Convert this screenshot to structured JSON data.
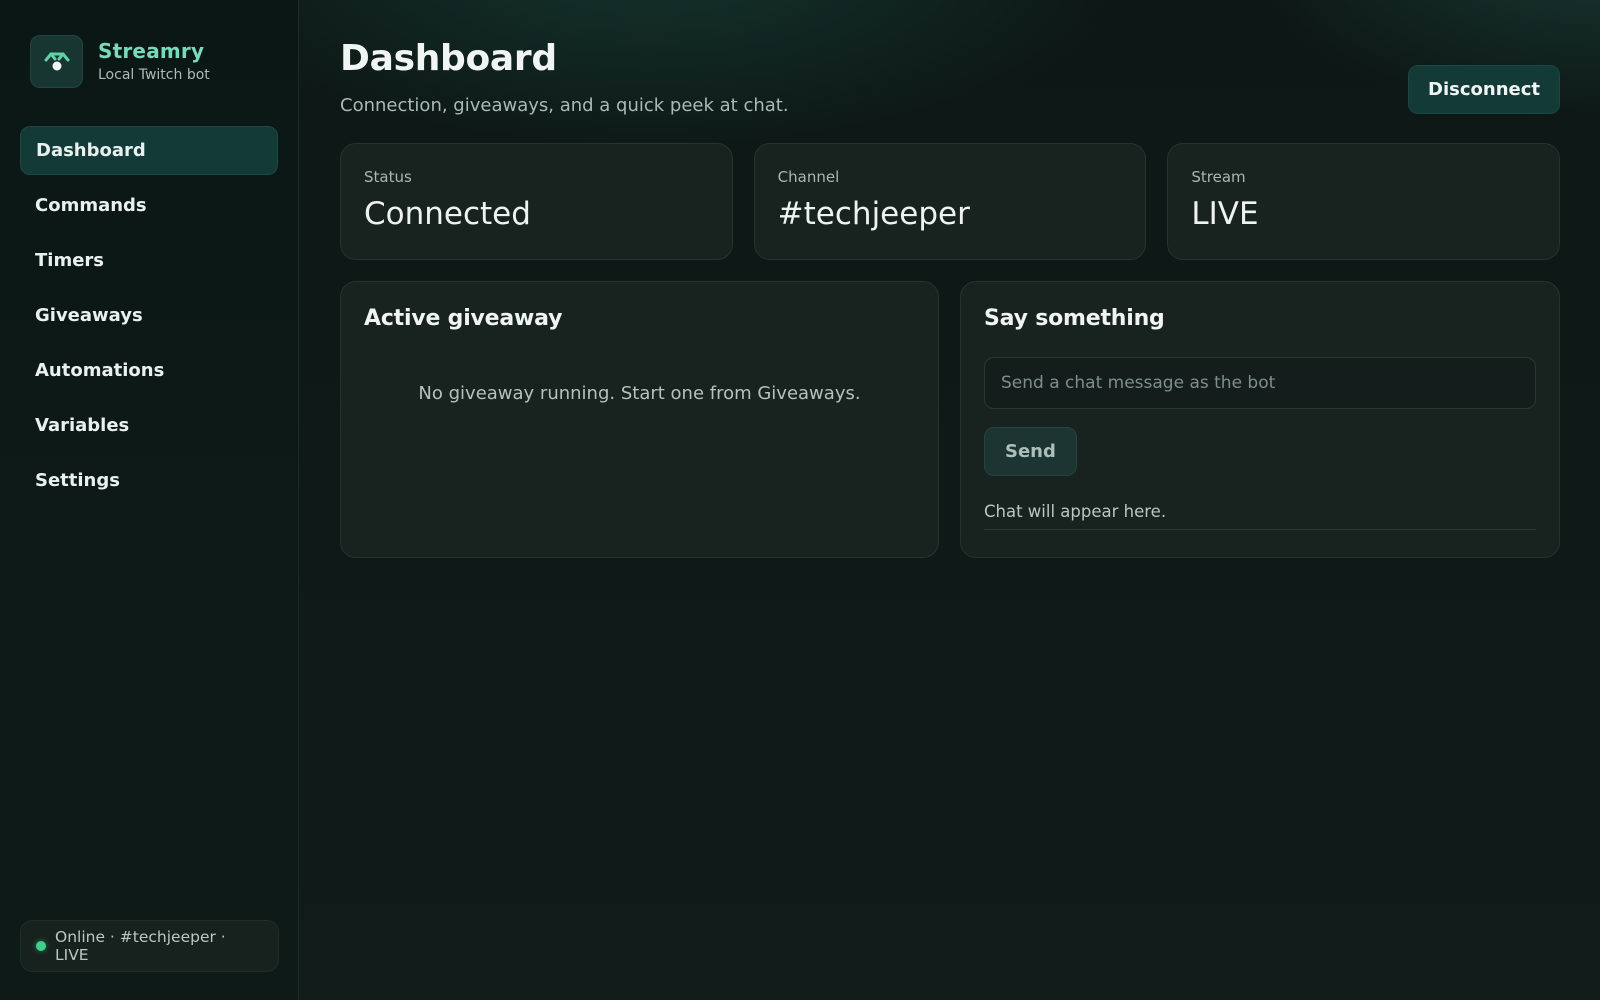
{
  "brand": {
    "name": "Streamry",
    "subtitle": "Local Twitch bot",
    "logo_icon": "robot-antenna-icon",
    "accent": "#79d9b8"
  },
  "sidebar": {
    "items": [
      {
        "label": "Dashboard",
        "active": true
      },
      {
        "label": "Commands",
        "active": false
      },
      {
        "label": "Timers",
        "active": false
      },
      {
        "label": "Giveaways",
        "active": false
      },
      {
        "label": "Automations",
        "active": false
      },
      {
        "label": "Variables",
        "active": false
      },
      {
        "label": "Settings",
        "active": false
      }
    ],
    "status_text": "Online · #techjeeper · LIVE",
    "status_color": "#3fd18c"
  },
  "header": {
    "title": "Dashboard",
    "subtitle": "Connection, giveaways, and a quick peek at chat.",
    "disconnect_label": "Disconnect"
  },
  "stats": [
    {
      "label": "Status",
      "value": "Connected"
    },
    {
      "label": "Channel",
      "value": "#techjeeper"
    },
    {
      "label": "Stream",
      "value": "LIVE"
    }
  ],
  "giveaway": {
    "title": "Active giveaway",
    "empty_message": "No giveaway running. Start one from Giveaways."
  },
  "chat": {
    "title": "Say something",
    "input_placeholder": "Send a chat message as the bot",
    "input_value": "",
    "send_label": "Send",
    "log_placeholder": "Chat will appear here."
  }
}
